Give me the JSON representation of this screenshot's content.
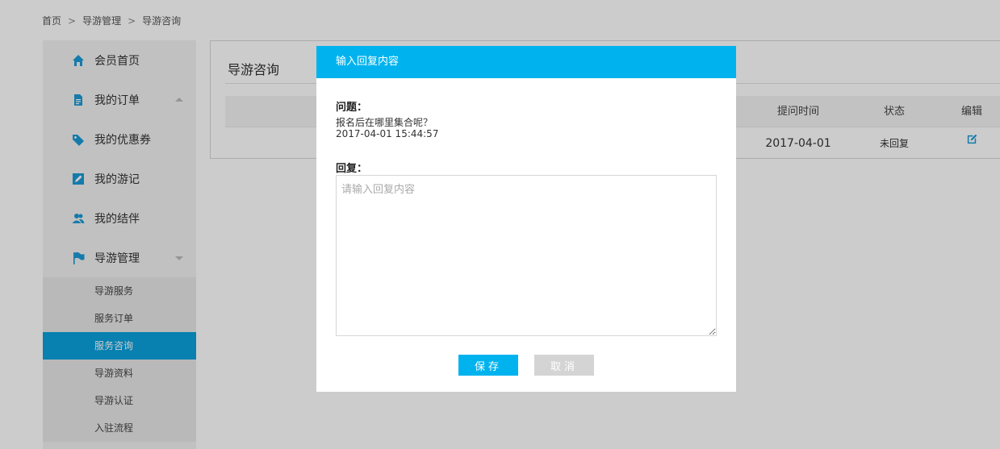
{
  "breadcrumb": [
    {
      "label": "首页"
    },
    {
      "label": "导游管理"
    },
    {
      "label": "导游咨询"
    }
  ],
  "breadcrumb_separator": ">",
  "sidebar": {
    "items": [
      {
        "label": "会员首页",
        "icon": "home-icon"
      },
      {
        "label": "我的订单",
        "icon": "document-icon"
      },
      {
        "label": "我的优惠券",
        "icon": "tag-icon"
      },
      {
        "label": "我的游记",
        "icon": "edit-icon"
      },
      {
        "label": "我的结伴",
        "icon": "users-icon"
      },
      {
        "label": "导游管理",
        "icon": "flag-icon"
      }
    ],
    "sub_items": [
      {
        "label": "导游服务"
      },
      {
        "label": "服务订单"
      },
      {
        "label": "服务咨询",
        "active": true
      },
      {
        "label": "导游资料"
      },
      {
        "label": "导游认证"
      },
      {
        "label": "入驻流程"
      }
    ]
  },
  "main": {
    "title": "导游咨询",
    "columns": {
      "time": "提问时间",
      "status": "状态",
      "edit": "编辑"
    },
    "rows": [
      {
        "time": "2017-04-01",
        "status": "未回复"
      }
    ]
  },
  "modal": {
    "title": "输入回复内容",
    "question_label": "问题：",
    "question_text": "报名后在哪里集合呢？",
    "question_time": "2017-04-01 15:44:57",
    "reply_label": "回复：",
    "reply_placeholder": "请输入回复内容",
    "reply_value": "",
    "save_label": "保存",
    "cancel_label": "取消"
  },
  "colors": {
    "accent": "#00b3ee",
    "active_nav": "#0aa0dc",
    "icon": "#1a9ad6",
    "cancel": "#d4d4d4"
  }
}
